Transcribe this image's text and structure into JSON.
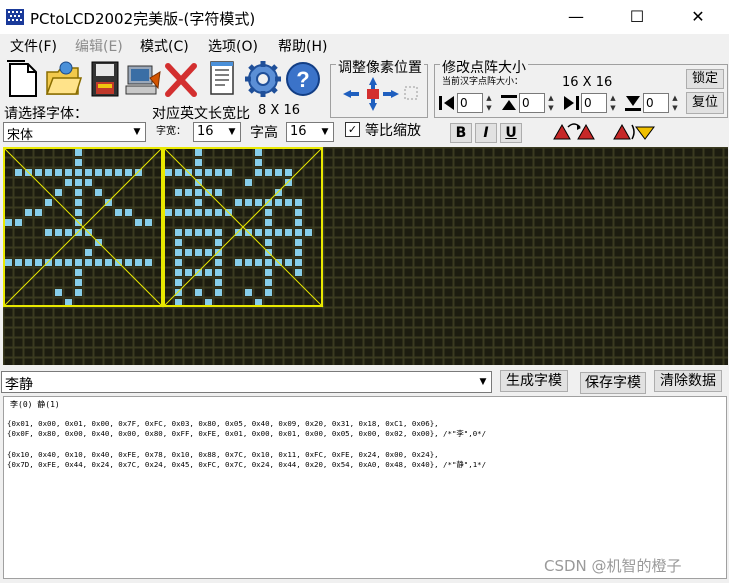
{
  "window": {
    "title": "PCtoLCD2002完美版-(字符模式)",
    "minimize": "—",
    "maximize": "☐",
    "close": "✕"
  },
  "menu": {
    "items": [
      {
        "label": "文件(F)",
        "enabled": true
      },
      {
        "label": "编辑(E)",
        "enabled": false
      },
      {
        "label": "模式(C)",
        "enabled": true
      },
      {
        "label": "选项(O)",
        "enabled": true
      },
      {
        "label": "帮助(H)",
        "enabled": true
      }
    ]
  },
  "toolbar": {
    "icons": [
      "new-file-icon",
      "open-folder-icon",
      "save-disk-icon",
      "computer-icon",
      "delete-x-icon",
      "notepad-icon",
      "settings-gear-icon",
      "help-icon"
    ],
    "adjust_title": "调整像素位置",
    "resize_title": "修改点阵大小",
    "current_size_label": "当前汉字点阵大小：",
    "current_size_value": "16 X 16",
    "lock_label": "锁定",
    "reset_label": "复位",
    "spin_values": [
      "0",
      "0",
      "0",
      "0"
    ]
  },
  "font": {
    "select_label": "请选择字体：",
    "ratio_label": "对应英文长宽比",
    "ratio_value": "8 X 16",
    "font_name": "宋体",
    "width_label": "字宽：",
    "width_value": "16",
    "height_label": "字高",
    "height_value": "16",
    "proportional_label": "等比缩放",
    "proportional_checked": true,
    "bold": "B",
    "italic": "I",
    "underline": "U"
  },
  "colors": {
    "grid_bg": "#1c1c10",
    "grid_line": "#3a3a20",
    "pixel_on": "#87ceeb",
    "frame": "#e8e800"
  },
  "input": {
    "text": "李静",
    "generate_label": "生成字模",
    "save_label": "保存字模",
    "clear_label": "清除数据"
  },
  "output": {
    "header": "李(0) 静(1)",
    "lines": [
      "{0x01, 0x00, 0x01, 0x00, 0x7F, 0xFC, 0x03, 0x80, 0x05, 0x40, 0x09, 0x20, 0x31, 0x18, 0xC1, 0x06},",
      "{0x0F, 0x80, 0x00, 0x40, 0x00, 0x80, 0xFF, 0xFE, 0x01, 0x00, 0x01, 0x00, 0x05, 0x00, 0x02, 0x00}, /*\"李\",0*/",
      "",
      "{0x10, 0x40, 0x10, 0x40, 0xFE, 0x78, 0x10, 0x88, 0x7C, 0x10, 0x11, 0xFC, 0xFE, 0x24, 0x00, 0x24},",
      "{0x7D, 0xFE, 0x44, 0x24, 0x7C, 0x24, 0x45, 0xFC, 0x7C, 0x24, 0x44, 0x20, 0x54, 0xA0, 0x48, 0x40}, /*\"静\",1*/"
    ]
  },
  "watermark": "CSDN @机智的橙子"
}
